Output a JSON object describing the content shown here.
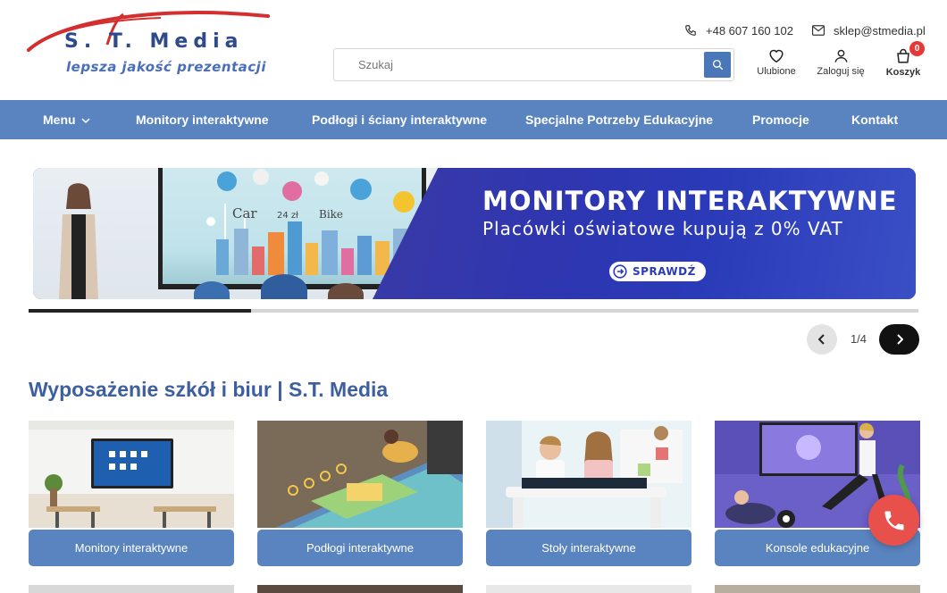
{
  "header": {
    "logo_text": "S.  T.  Media",
    "logo_tagline": "lepsza jakość prezentacji",
    "phone": "+48 607 160 102",
    "email": "sklep@stmedia.pl",
    "search_placeholder": "Szukaj",
    "actions": {
      "favorites": "Ulubione",
      "login": "Zaloguj się",
      "cart": "Koszyk",
      "cart_count": "0"
    }
  },
  "nav": {
    "items": [
      {
        "label": "Menu"
      },
      {
        "label": "Monitory interaktywne"
      },
      {
        "label": "Podłogi i ściany interaktywne"
      },
      {
        "label": "Specjalne Potrzeby Edukacyjne"
      },
      {
        "label": "Promocje"
      },
      {
        "label": "Kontakt"
      }
    ]
  },
  "banner": {
    "title": "MONITORY INTERAKTYWNE",
    "subtitle": "Placówki oświatowe kupują z 0% VAT",
    "button": "SPRAWDŹ",
    "board_words": [
      "Car",
      "Bike",
      "24 zł"
    ]
  },
  "carousel": {
    "counter": "1/4",
    "progress": 0.25
  },
  "section": {
    "title": "Wyposażenie szkół i biur | S.T. Media",
    "categories": [
      {
        "label": "Monitory interaktywne"
      },
      {
        "label": "Podłogi interaktywne"
      },
      {
        "label": "Stoły interaktywne"
      },
      {
        "label": "Konsole edukacyjne"
      }
    ]
  },
  "colors": {
    "brand_blue": "#5a84bf",
    "dark_blue": "#3d5fa0",
    "banner_blue": "#2e36b0",
    "logo_red": "#d32f2f",
    "call_red": "#e8514b"
  }
}
